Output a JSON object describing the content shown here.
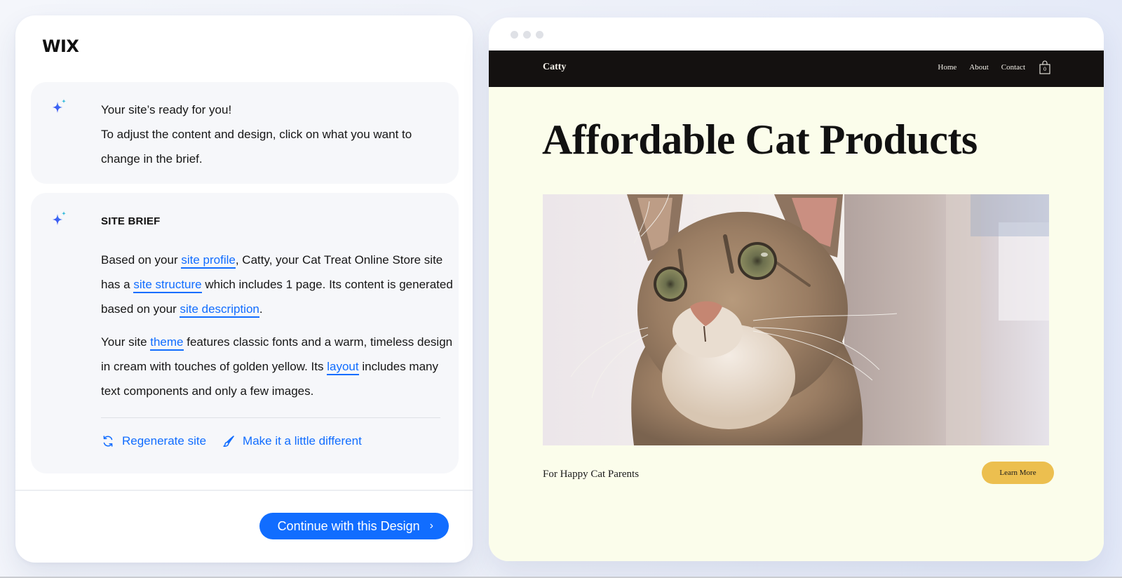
{
  "left_panel": {
    "logo": "WIX",
    "ready_card": {
      "icon": "sparkle-icon",
      "line1": "Your site’s ready for you!",
      "line2": "To adjust the content and design, click on what you want to change in the brief."
    },
    "brief_card": {
      "icon": "sparkle-icon",
      "title": "SITE BRIEF",
      "paragraph1": {
        "t1": "Based on your ",
        "link1": "site profile",
        "t2": ", Catty, your Cat Treat Online Store site has a ",
        "link2": "site structure",
        "t3": " which includes 1 page. Its content is generated based on your ",
        "link3": "site description",
        "t4": "."
      },
      "paragraph2": {
        "t1": "Your site ",
        "link1": "theme",
        "t2": " features classic fonts and a warm, timeless design in cream with touches of golden yellow. Its ",
        "link2": "layout",
        "t3": " includes many text components and only a few images."
      },
      "actions": [
        {
          "icon": "refresh-icon",
          "label": "Regenerate site"
        },
        {
          "icon": "paintbrush-icon",
          "label": "Make it a little different"
        }
      ]
    },
    "continue_button": {
      "label": "Continue with this Design",
      "icon": "chevron-right-icon",
      "chevron": "›"
    }
  },
  "preview": {
    "window_dots": 3,
    "site": {
      "logo": "Catty",
      "nav": [
        "Home",
        "About",
        "Contact"
      ],
      "cart": {
        "icon": "shopping-bag-icon",
        "count": "0"
      },
      "hero_title": "Affordable Cat Products",
      "hero_image": "tabby-cat-photo",
      "tagline": "For Happy Cat Parents",
      "cta": "Learn More"
    }
  },
  "colors": {
    "accent_blue": "#116dff",
    "site_background": "#fbfdeb",
    "site_nav": "#141110",
    "cta_yellow": "#ecbf4f"
  }
}
